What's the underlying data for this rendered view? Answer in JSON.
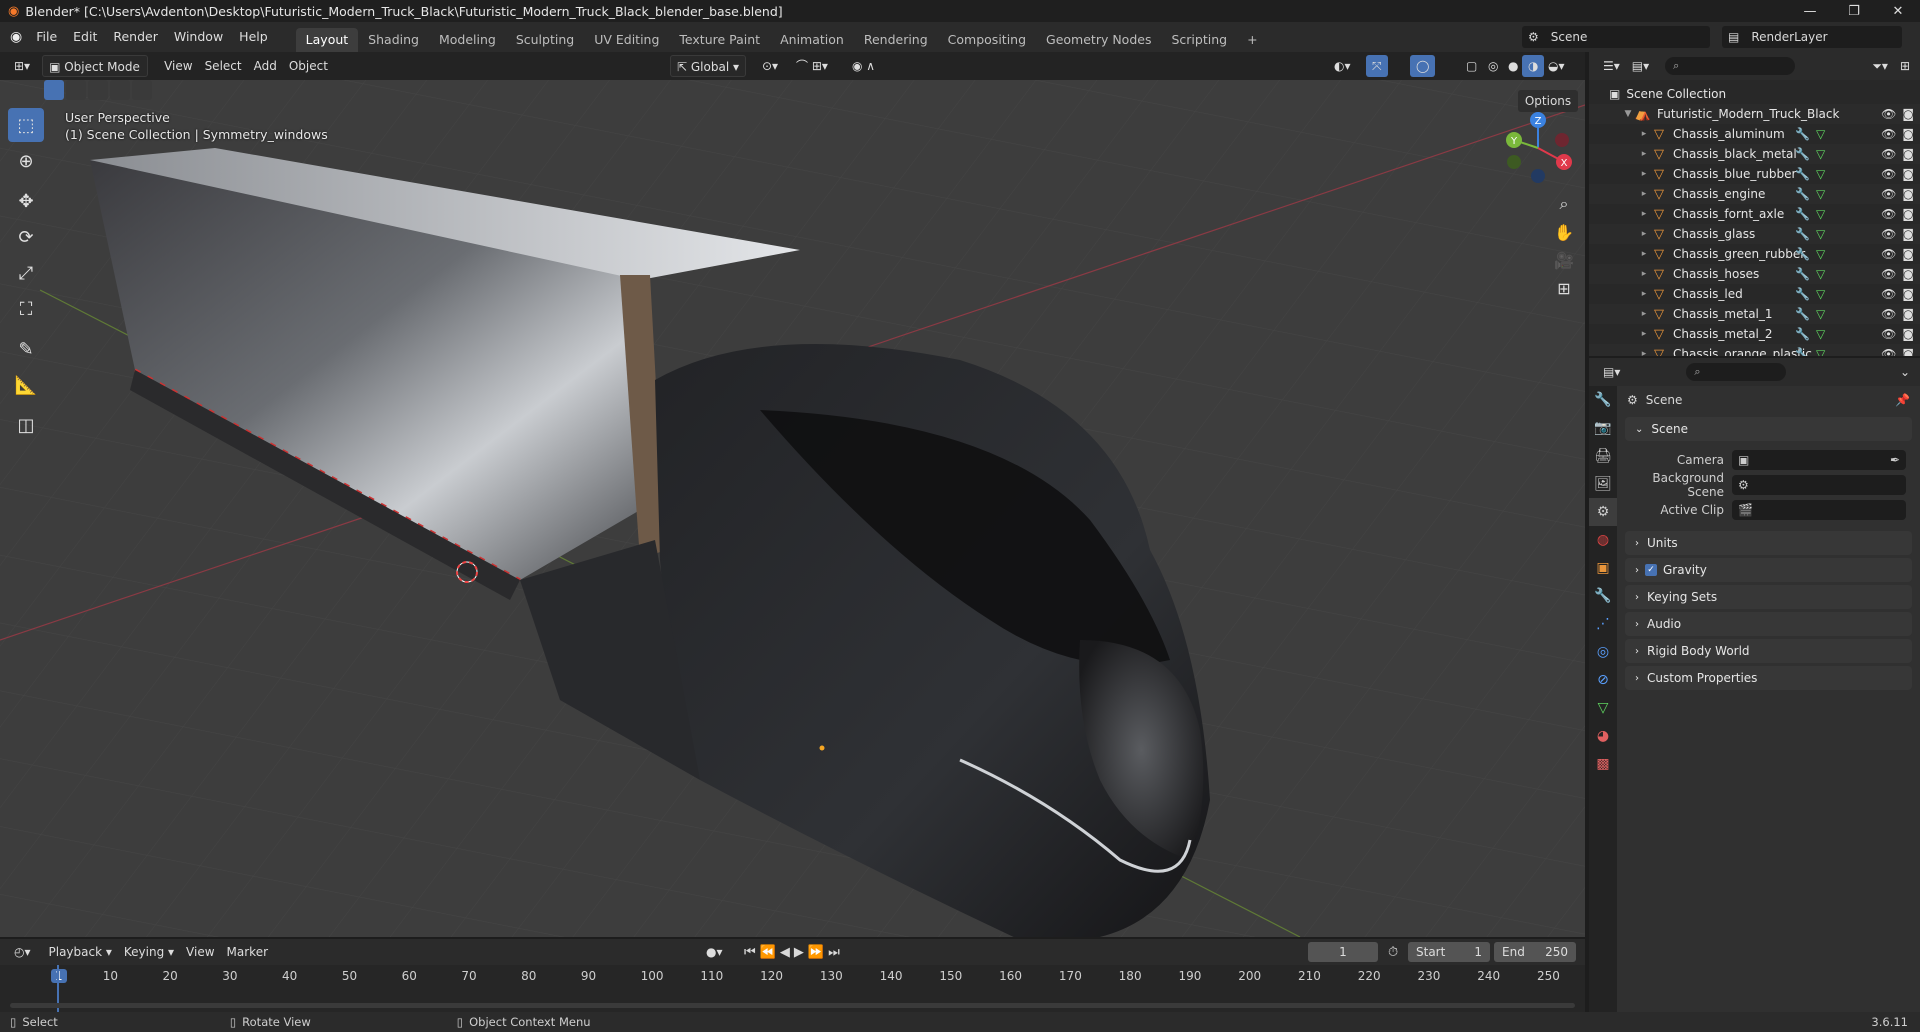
{
  "window": {
    "title": "Blender* [C:\\Users\\Avdenton\\Desktop\\Futuristic_Modern_Truck_Black\\Futuristic_Modern_Truck_Black_blender_base.blend]",
    "minimize": "—",
    "maximize": "❐",
    "close": "✕"
  },
  "menubar": {
    "items": [
      "File",
      "Edit",
      "Render",
      "Window",
      "Help"
    ],
    "workspaces": [
      "Layout",
      "Shading",
      "Modeling",
      "Sculpting",
      "UV Editing",
      "Texture Paint",
      "Animation",
      "Rendering",
      "Compositing",
      "Geometry Nodes",
      "Scripting"
    ],
    "add_tab": "+",
    "scene": "Scene",
    "render_layer": "RenderLayer"
  },
  "viewport_header": {
    "mode": "Object Mode",
    "menus": [
      "View",
      "Select",
      "Add",
      "Object"
    ],
    "orientation": "Global",
    "options": "Options"
  },
  "viewport": {
    "perspective": "User Perspective",
    "collection_info": "(1) Scene Collection | Symmetry_windows",
    "gizmo": {
      "z": "Z",
      "y": "Y",
      "x": "X"
    }
  },
  "outliner": {
    "root": "Scene Collection",
    "collection": "Futuristic_Modern_Truck_Black",
    "objects": [
      "Chassis_aluminum",
      "Chassis_black_metal",
      "Chassis_blue_rubber",
      "Chassis_engine",
      "Chassis_fornt_axle",
      "Chassis_glass",
      "Chassis_green_rubber",
      "Chassis_hoses",
      "Chassis_led",
      "Chassis_metal_1",
      "Chassis_metal_2",
      "Chassis_orange_plastic"
    ]
  },
  "properties": {
    "context": "Scene",
    "panel": "Scene",
    "rows": [
      {
        "label": "Camera",
        "value": ""
      },
      {
        "label": "Background Scene",
        "value": ""
      },
      {
        "label": "Active Clip",
        "value": ""
      }
    ],
    "subpanels": [
      "Units",
      "Gravity",
      "Keying Sets",
      "Audio",
      "Rigid Body World",
      "Custom Properties"
    ]
  },
  "timeline": {
    "menus": [
      "Playback",
      "Keying",
      "View",
      "Marker"
    ],
    "current_frame": "1",
    "start_label": "Start",
    "start": "1",
    "end_label": "End",
    "end": "250",
    "ticks": [
      "1",
      "10",
      "20",
      "30",
      "40",
      "50",
      "60",
      "70",
      "80",
      "90",
      "100",
      "110",
      "120",
      "130",
      "140",
      "150",
      "160",
      "170",
      "180",
      "190",
      "200",
      "210",
      "220",
      "230",
      "240",
      "250"
    ]
  },
  "statusbar": {
    "select": "Select",
    "rotate": "Rotate View",
    "context_menu": "Object Context Menu",
    "version": "3.6.11"
  },
  "colors": {
    "accent": "#4772b3",
    "object_icon": "#e8953b",
    "axis_x": "#e0394b",
    "axis_y": "#7ab83b",
    "axis_z": "#3b82e0"
  }
}
